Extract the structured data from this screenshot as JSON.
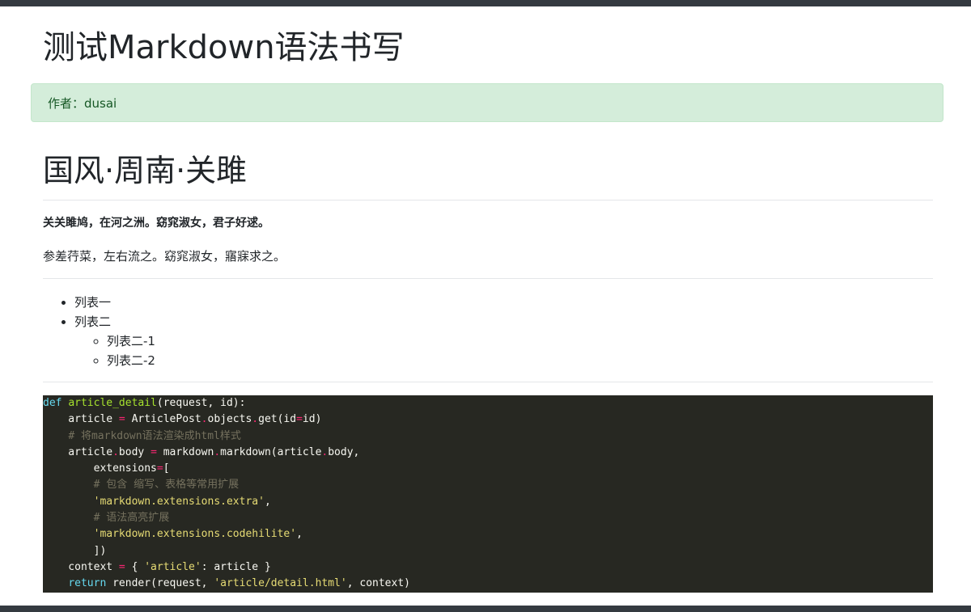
{
  "header": {
    "title": "测试Markdown语法书写"
  },
  "alert": {
    "author_text": "作者：dusai"
  },
  "content": {
    "section_title": "国风·周南·关雎",
    "poem_line_bold": "关关雎鸠，在河之洲。窈窕淑女，君子好逑。",
    "poem_line_normal": "参差荇菜，左右流之。窈窕淑女，寤寐求之。",
    "list_items": [
      "列表一",
      "列表二"
    ],
    "sub_list_items": [
      "列表二-1",
      "列表二-2"
    ]
  },
  "code_block": {
    "language": "python",
    "lines": [
      [
        [
          "kw",
          "def"
        ],
        [
          "txt",
          " "
        ],
        [
          "fn",
          "article_detail"
        ],
        [
          "txt",
          "(request, id):"
        ]
      ],
      [
        [
          "txt",
          "    article "
        ],
        [
          "op",
          "="
        ],
        [
          "txt",
          " ArticlePost"
        ],
        [
          "op",
          "."
        ],
        [
          "txt",
          "objects"
        ],
        [
          "op",
          "."
        ],
        [
          "txt",
          "get(id"
        ],
        [
          "op",
          "="
        ],
        [
          "txt",
          "id)"
        ]
      ],
      [
        [
          "txt",
          "    "
        ],
        [
          "cm",
          "# 将markdown语法渲染成html样式"
        ]
      ],
      [
        [
          "txt",
          "    article"
        ],
        [
          "op",
          "."
        ],
        [
          "txt",
          "body "
        ],
        [
          "op",
          "="
        ],
        [
          "txt",
          " markdown"
        ],
        [
          "op",
          "."
        ],
        [
          "txt",
          "markdown(article"
        ],
        [
          "op",
          "."
        ],
        [
          "txt",
          "body,"
        ]
      ],
      [
        [
          "txt",
          "        extensions"
        ],
        [
          "op",
          "="
        ],
        [
          "txt",
          "["
        ]
      ],
      [
        [
          "txt",
          "        "
        ],
        [
          "cm",
          "# 包含 缩写、表格等常用扩展"
        ]
      ],
      [
        [
          "txt",
          "        "
        ],
        [
          "str",
          "'markdown.extensions.extra'"
        ],
        [
          "txt",
          ","
        ]
      ],
      [
        [
          "txt",
          "        "
        ],
        [
          "cm",
          "# 语法高亮扩展"
        ]
      ],
      [
        [
          "txt",
          "        "
        ],
        [
          "str",
          "'markdown.extensions.codehilite'"
        ],
        [
          "txt",
          ","
        ]
      ],
      [
        [
          "txt",
          "        ])"
        ]
      ],
      [
        [
          "txt",
          "    context "
        ],
        [
          "op",
          "="
        ],
        [
          "txt",
          " { "
        ],
        [
          "str",
          "'article'"
        ],
        [
          "txt",
          ": article }"
        ]
      ],
      [
        [
          "txt",
          "    "
        ],
        [
          "kw",
          "return"
        ],
        [
          "txt",
          " render(request, "
        ],
        [
          "str",
          "'article/detail.html'"
        ],
        [
          "txt",
          ", context)"
        ]
      ]
    ]
  },
  "colors": {
    "topbar": "#343a40",
    "alert_bg": "#d4edda",
    "alert_text": "#155724",
    "code_bg": "#272822"
  }
}
